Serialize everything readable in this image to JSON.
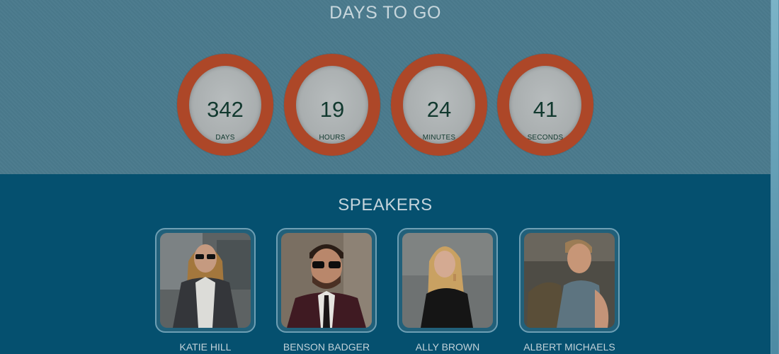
{
  "countdown": {
    "title": "DAYS TO GO",
    "items": [
      {
        "value": "342",
        "unit": "DAYS"
      },
      {
        "value": "19",
        "unit": "HOURS"
      },
      {
        "value": "24",
        "unit": "MINUTES"
      },
      {
        "value": "41",
        "unit": "SECONDS"
      }
    ],
    "colors": {
      "ring": "#ad4728",
      "face": "#b1b6b7",
      "text": "#12392f"
    }
  },
  "speakers": {
    "title": "SPEAKERS",
    "items": [
      {
        "name": "KATIE HILL"
      },
      {
        "name": "BENSON BADGER"
      },
      {
        "name": "ALLY BROWN"
      },
      {
        "name": "ALBERT MICHAELS"
      }
    ]
  }
}
